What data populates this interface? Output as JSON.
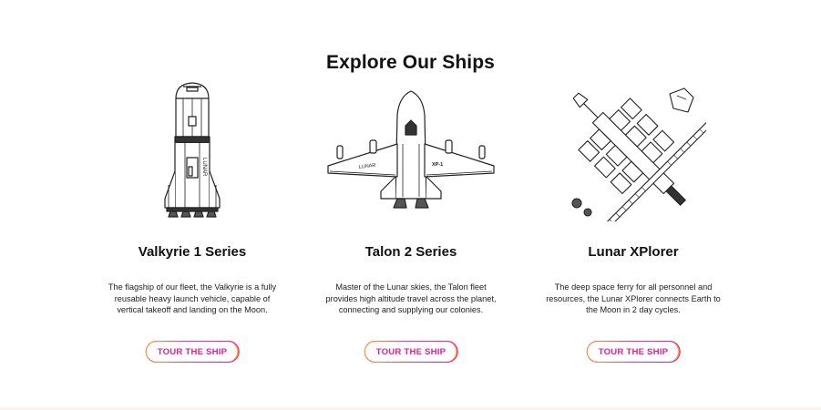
{
  "section": {
    "title": "Explore Our Ships"
  },
  "ships": [
    {
      "name": "Valkyrie 1 Series",
      "description": "The flagship of our fleet, the Valkyrie is a fully reusable heavy launch vehicle, capable of vertical takeoff and landing on the Moon.",
      "button_label": "TOUR THE SHIP",
      "hull_text": "LUNAR"
    },
    {
      "name": "Talon 2 Series",
      "description": "Master of the Lunar skies, the Talon fleet provides high altitude travel across the planet, connecting and supplying our colonies.",
      "button_label": "TOUR THE SHIP",
      "hull_text": "LUNAR",
      "tail_code": "XP-1"
    },
    {
      "name": "Lunar XPlorer",
      "description": "The deep space ferry for all personnel and resources, the Lunar XPlorer connects Earth to the Moon in 2 day cycles.",
      "button_label": "TOUR THE SHIP"
    }
  ],
  "colors": {
    "accent_pink": "#e0208e",
    "accent_orange": "#f6a12a"
  }
}
